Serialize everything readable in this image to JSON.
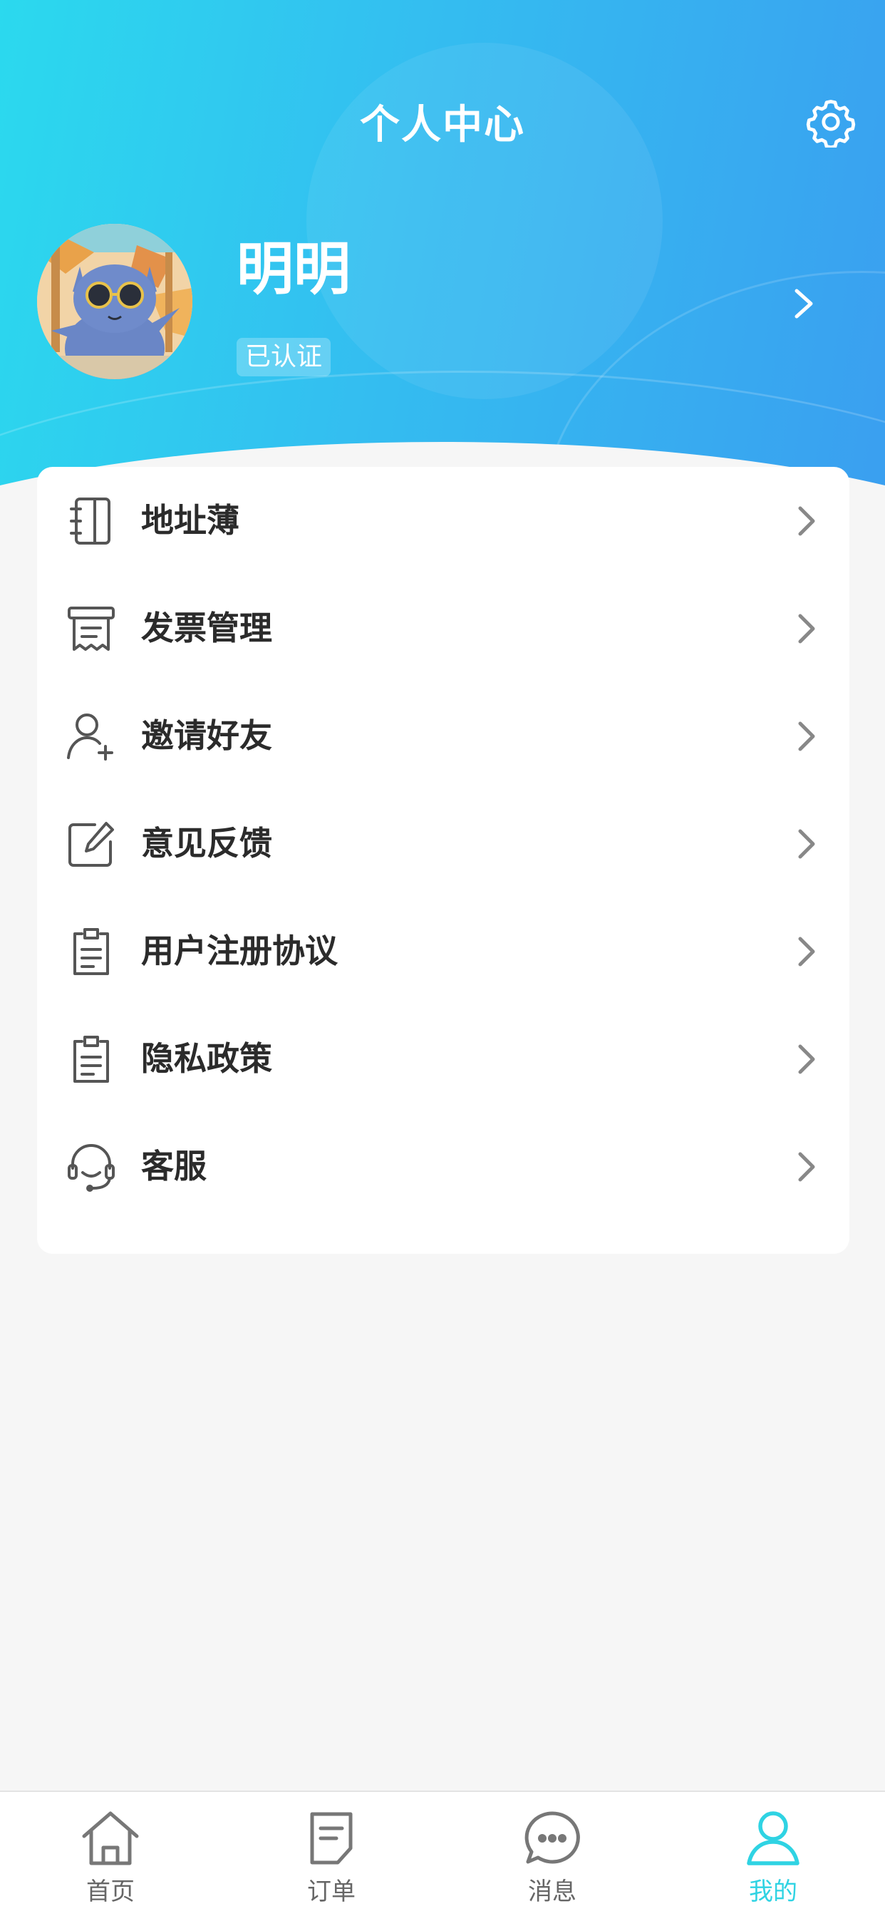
{
  "header": {
    "title": "个人中心",
    "settings_icon": "gear-icon"
  },
  "profile": {
    "name": "明明",
    "badge": "已认证",
    "avatar_icon": "cat-with-sunglasses-avatar"
  },
  "menu": {
    "items": [
      {
        "label": "地址薄",
        "icon": "address-book-icon"
      },
      {
        "label": "发票管理",
        "icon": "invoice-icon"
      },
      {
        "label": "邀请好友",
        "icon": "add-user-icon"
      },
      {
        "label": "意见反馈",
        "icon": "edit-feedback-icon"
      },
      {
        "label": "用户注册协议",
        "icon": "clipboard-icon"
      },
      {
        "label": "隐私政策",
        "icon": "clipboard-icon"
      },
      {
        "label": "客服",
        "icon": "headset-icon"
      }
    ]
  },
  "tabbar": {
    "tabs": [
      {
        "label": "首页",
        "icon": "home-icon",
        "active": false
      },
      {
        "label": "订单",
        "icon": "order-icon",
        "active": false
      },
      {
        "label": "消息",
        "icon": "message-icon",
        "active": false
      },
      {
        "label": "我的",
        "icon": "user-icon",
        "active": true
      }
    ]
  },
  "colors": {
    "header_gradient_start": "#2bd9ee",
    "header_gradient_end": "#3a9ff0",
    "active_tab": "#2fd3e3",
    "inactive_tab": "#666666",
    "menu_text": "#2b2b2b",
    "background": "#f6f6f6"
  }
}
